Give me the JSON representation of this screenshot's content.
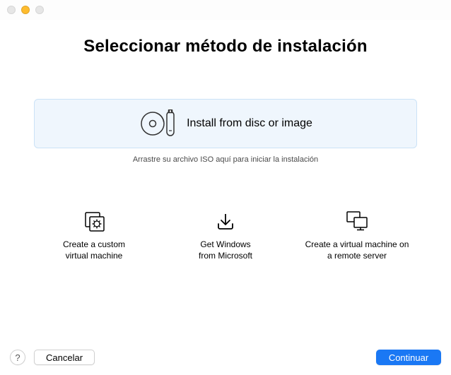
{
  "title": "Seleccionar método de instalación",
  "dropzone": {
    "label": "Install from disc or image",
    "hint": "Arrastre su archivo ISO aquí para iniciar la instalación"
  },
  "options": [
    {
      "label": "Create a custom\nvirtual machine"
    },
    {
      "label": "Get Windows\nfrom Microsoft"
    },
    {
      "label": "Create a virtual machine on\na remote server"
    }
  ],
  "footer": {
    "help_label": "?",
    "cancel_label": "Cancelar",
    "continue_label": "Continuar"
  }
}
